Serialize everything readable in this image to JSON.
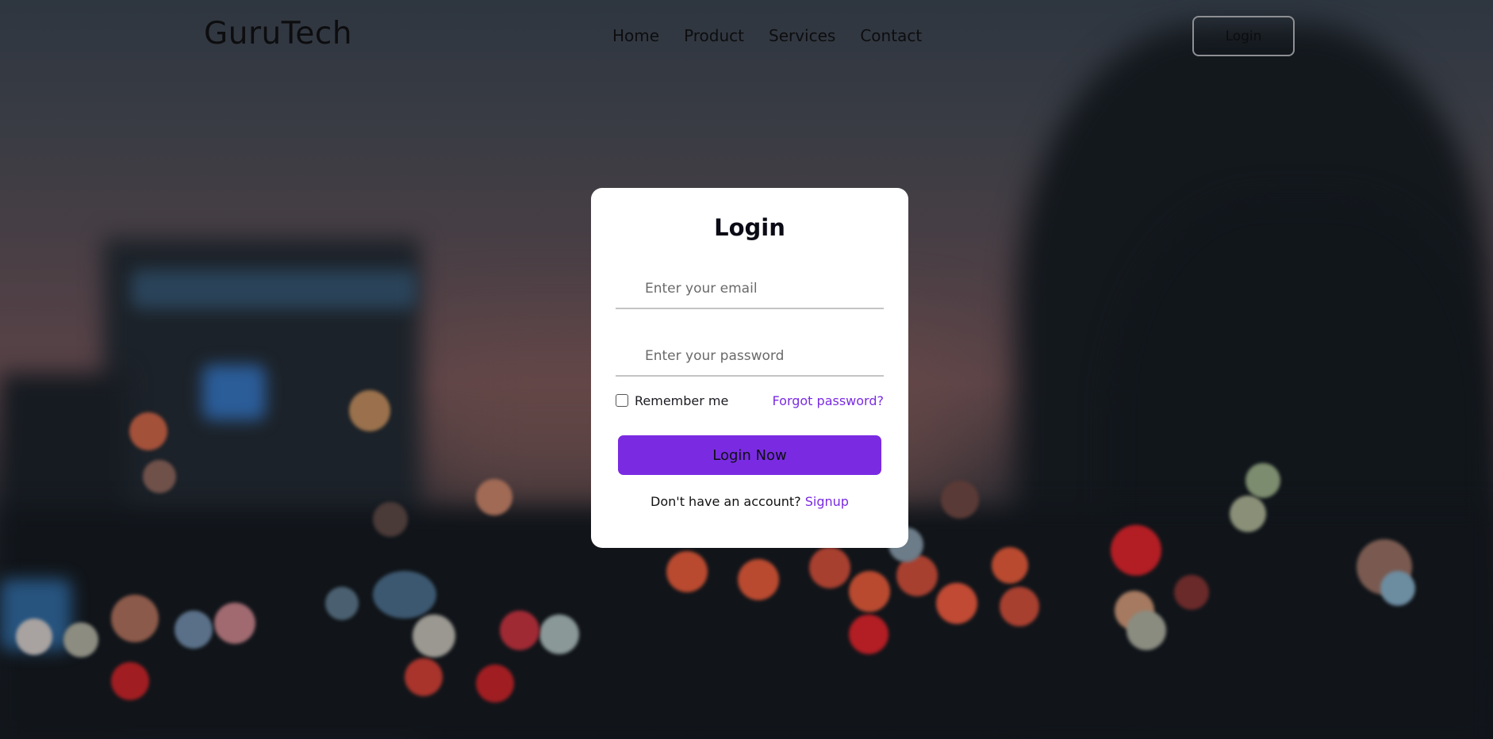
{
  "brand": {
    "name": "GuruTech"
  },
  "nav": {
    "items": [
      "Home",
      "Product",
      "Services",
      "Contact"
    ],
    "login_label": "Login"
  },
  "form": {
    "title": "Login",
    "email_placeholder": "Enter your email",
    "password_placeholder": "Enter your password",
    "remember_label": "Remember me",
    "remember_checked": false,
    "forgot_label": "Forgot password?",
    "submit_label": "Login Now",
    "signup_prompt": "Don't have an account?",
    "signup_link": "Signup"
  },
  "colors": {
    "accent": "#7a2be2",
    "card": "#ffffff",
    "text": "#0d0d0f"
  }
}
